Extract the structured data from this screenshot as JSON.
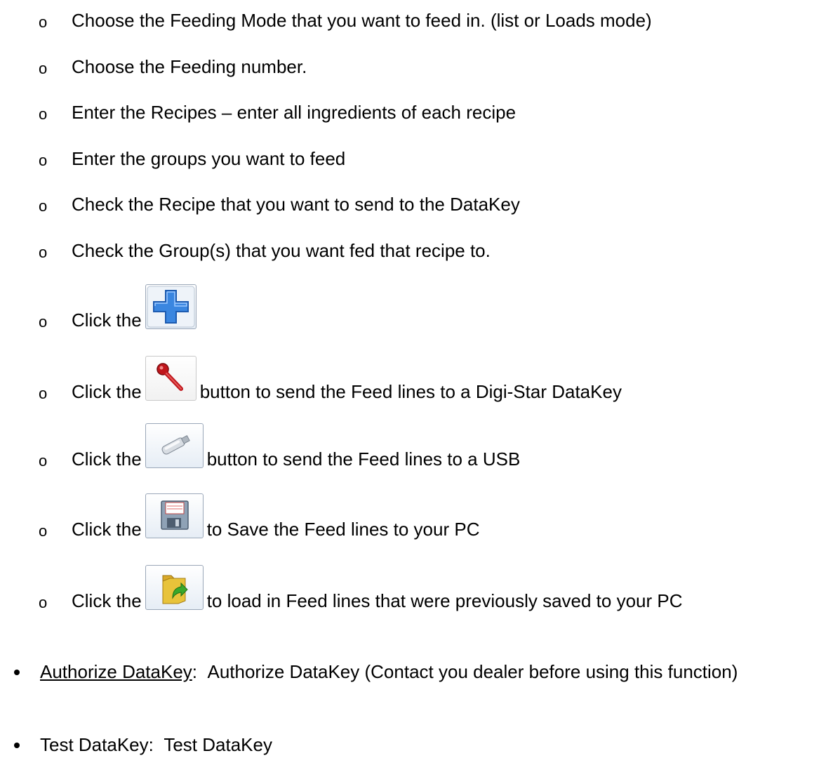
{
  "steps": [
    {
      "bullet": "o",
      "text": "Choose the Feeding Mode that you want to feed in. (list or Loads mode)"
    },
    {
      "bullet": "o",
      "text": "Choose the Feeding number."
    },
    {
      "bullet": "o",
      "text": "Enter the Recipes – enter all ingredients of each recipe"
    },
    {
      "bullet": "o",
      "text": "Enter the groups you want to feed"
    },
    {
      "bullet": "o",
      "text": "Check the Recipe that you want to send to the DataKey"
    },
    {
      "bullet": "o",
      "text": "Check the Group(s) that you want fed that recipe to."
    }
  ],
  "icon_steps": [
    {
      "bullet": "o",
      "prefix": "Click the",
      "icon": "plus-icon",
      "suffix": ""
    },
    {
      "bullet": "o",
      "prefix": "Click the",
      "icon": "datakey-icon",
      "suffix": "button to send the Feed lines to a Digi-Star DataKey"
    },
    {
      "bullet": "o",
      "prefix": "Click the",
      "icon": "usb-icon",
      "suffix": "button to send the Feed lines to a USB"
    },
    {
      "bullet": "o",
      "prefix": "Click the",
      "icon": "save-icon",
      "suffix": "to Save the Feed lines to your PC"
    },
    {
      "bullet": "o",
      "prefix": "Click the",
      "icon": "open-folder-icon",
      "suffix": "to load in Feed lines that were previously saved to your PC"
    }
  ],
  "functions": [
    {
      "name": "Authorize DataKey",
      "separator": ":",
      "description": "Authorize DataKey (Contact you dealer before using this function)"
    },
    {
      "name": "Test DataKey",
      "separator": ":",
      "description": "Test DataKey"
    }
  ],
  "colors": {
    "text": "#000000",
    "plus_fill": "#3a86e0",
    "key_red": "#c0161c",
    "folder_yellow": "#e8c33a",
    "arrow_green": "#3aa82b"
  }
}
